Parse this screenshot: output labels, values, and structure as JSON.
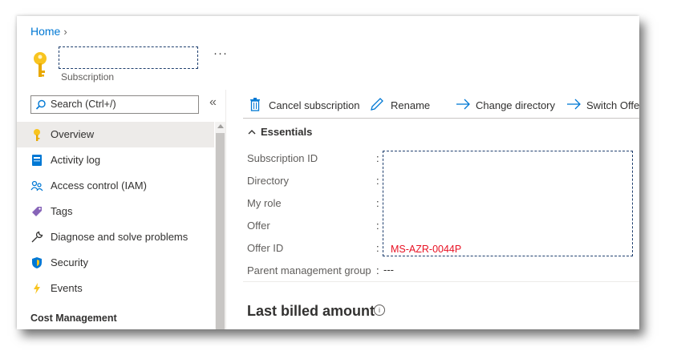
{
  "breadcrumb": {
    "home": "Home"
  },
  "resource": {
    "type_label": "Subscription",
    "more_label": "···"
  },
  "search": {
    "placeholder": "Search (Ctrl+/)"
  },
  "collapse_label": "«",
  "nav": {
    "items": [
      {
        "label": "Overview",
        "icon": "key-icon",
        "active": true
      },
      {
        "label": "Activity log",
        "icon": "activity-log-icon"
      },
      {
        "label": "Access control (IAM)",
        "icon": "people-icon"
      },
      {
        "label": "Tags",
        "icon": "tag-icon"
      },
      {
        "label": "Diagnose and solve problems",
        "icon": "wrench-icon"
      },
      {
        "label": "Security",
        "icon": "shield-icon"
      },
      {
        "label": "Events",
        "icon": "lightning-icon"
      }
    ],
    "section_header": "Cost Management"
  },
  "toolbar": {
    "cancel": "Cancel subscription",
    "rename": "Rename",
    "change_directory": "Change directory",
    "switch_offer": "Switch Offer"
  },
  "essentials": {
    "header": "Essentials",
    "labels": {
      "subscription_id": "Subscription ID",
      "directory": "Directory",
      "my_role": "My role",
      "offer": "Offer",
      "offer_id": "Offer ID",
      "parent_group": "Parent management group"
    },
    "colon": ":",
    "offer_id_value": "MS-AZR-0044P",
    "parent_group_value": "---"
  },
  "billing": {
    "title": "Last billed amount",
    "info_icon": "i"
  },
  "colors": {
    "accent": "#0078d4",
    "key_yellow": "#f8c41f",
    "annotation_red": "#e81123",
    "annotation_box": "#1f3f6e"
  }
}
